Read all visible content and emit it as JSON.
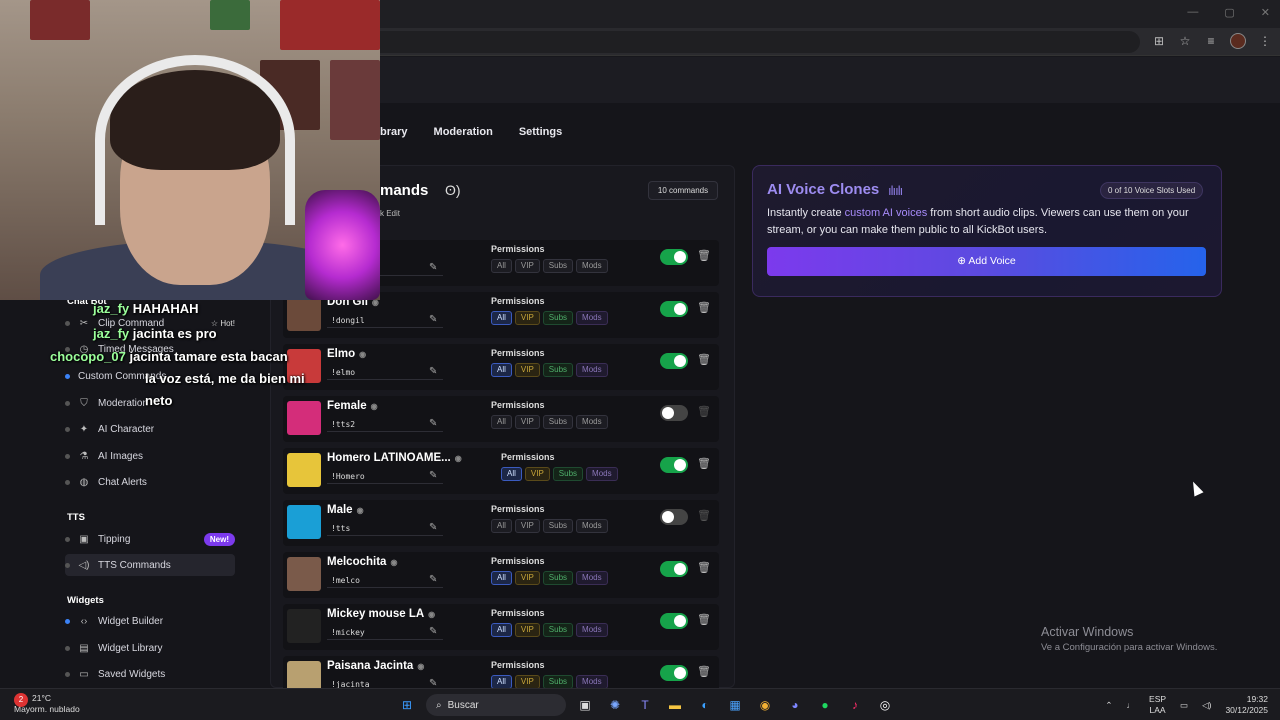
{
  "nav": {
    "tabs": [
      "brary",
      "Moderation",
      "Settings"
    ]
  },
  "sidebar": {
    "chatbot_section": "Chat Bot",
    "tts_section": "TTS",
    "widgets_section": "Widgets",
    "items": {
      "clip_command": "Clip Command",
      "hot_badge": "☆ Hot!",
      "timed_messages": "Timed Messages",
      "custom_commands": "Custom Commands",
      "moderation": "Moderation",
      "ai_character": "AI Character",
      "ai_images": "AI Images",
      "chat_alerts": "Chat Alerts",
      "tipping": "Tipping",
      "new_badge": "New!",
      "tts_commands": "TTS Commands",
      "widget_builder": "Widget Builder",
      "widget_library": "Widget Library",
      "saved_widgets": "Saved Widgets"
    }
  },
  "commands": {
    "title": "mands",
    "bulk_edit": "k Edit",
    "count": "10 commands",
    "permissions_label": "Permissions",
    "pill_labels": [
      "All",
      "VIP",
      "Subs",
      "Mods"
    ],
    "rows": [
      {
        "name": "",
        "trigger": "",
        "enabled": true
      },
      {
        "name": "Don Gil",
        "trigger": "!dongil",
        "enabled": true
      },
      {
        "name": "Elmo",
        "trigger": "!elmo",
        "enabled": true
      },
      {
        "name": "Female",
        "trigger": "!tts2",
        "enabled": false
      },
      {
        "name": "Homero LATINOAME...",
        "trigger": "!Homero",
        "enabled": true
      },
      {
        "name": "Male",
        "trigger": "!tts",
        "enabled": false
      },
      {
        "name": "Melcochita",
        "trigger": "!melco",
        "enabled": true
      },
      {
        "name": "Mickey mouse LA",
        "trigger": "!mickey",
        "enabled": true
      },
      {
        "name": "Paisana Jacinta",
        "trigger": "!jacinta",
        "enabled": true
      }
    ]
  },
  "voice_clones": {
    "title": "AI Voice Clones",
    "slots": "0 of 10 Voice Slots Used",
    "desc_before": "Instantly create ",
    "desc_highlight": "custom AI voices",
    "desc_after": " from short audio clips. Viewers can use them on your stream, or you can make them public to all KickBot users.",
    "add_button": "Add Voice"
  },
  "activate": {
    "line1": "Activar Windows",
    "line2": "Ve a Configuración para activar Windows."
  },
  "chat": [
    {
      "user": "jaz_fy",
      "msg": "HAHAHAH"
    },
    {
      "user": "jaz_fy",
      "msg": "jacinta es pro"
    },
    {
      "user": "chocopo_07",
      "msg": "jacinta tamare esta bacan"
    },
    {
      "user": "",
      "msg": "la voz está, me da bien mi"
    },
    {
      "user": "",
      "msg": "neto"
    }
  ],
  "taskbar": {
    "temp": "21°C",
    "weather": "Mayorm. nublado",
    "weather_badge": "2",
    "search": "Buscar",
    "lang1": "ESP",
    "lang2": "LAA",
    "time": "19:32",
    "date": "30/12/2025"
  },
  "colors": {
    "accent_purple": "#7c3aed",
    "accent_blue": "#2563eb",
    "toggle_on": "#16a34a"
  }
}
